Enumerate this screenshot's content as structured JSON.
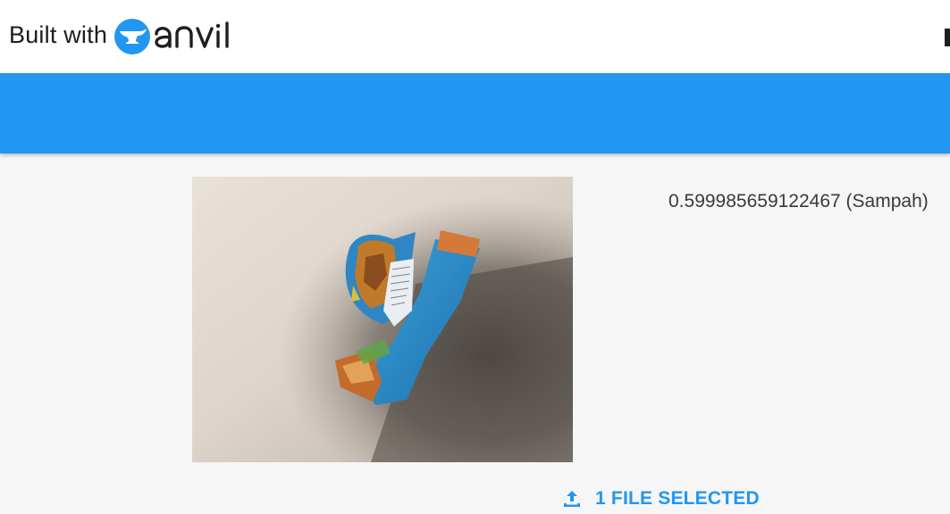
{
  "header": {
    "built_with_label": "Built with",
    "brand_name": "anvil",
    "brand_color": "#2196f3",
    "accent_color": "#2196f3"
  },
  "main": {
    "image": {
      "description_icon": "photo-of-crumpled-snack-wrapper"
    },
    "prediction_text": "0.599985659122467 (Sampah)"
  },
  "upload": {
    "icon": "upload-icon",
    "label": "1 FILE SELECTED"
  }
}
